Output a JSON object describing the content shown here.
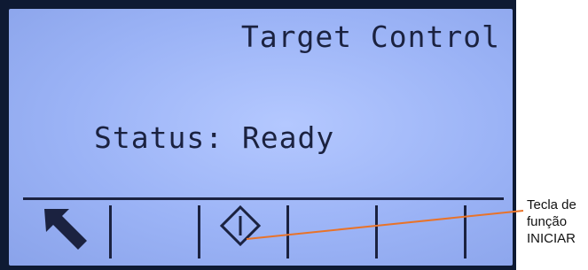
{
  "display": {
    "title": "Target Control",
    "status_text": "Status: Ready"
  },
  "softkeys": [
    {
      "name": "exit",
      "icon": "exit-arrow-icon"
    },
    {
      "name": "blank-2",
      "icon": ""
    },
    {
      "name": "start",
      "icon": "start-diamond-icon"
    },
    {
      "name": "blank-4",
      "icon": ""
    },
    {
      "name": "blank-5",
      "icon": ""
    },
    {
      "name": "blank-6",
      "icon": ""
    }
  ],
  "callout": {
    "lines": [
      "Tecla de",
      "função",
      "INICIAR"
    ],
    "line_color": "#e8732a"
  },
  "colors": {
    "lcd_background": "#a8bdfb",
    "lcd_text": "#1b2240",
    "bezel": "#0e1a33"
  }
}
